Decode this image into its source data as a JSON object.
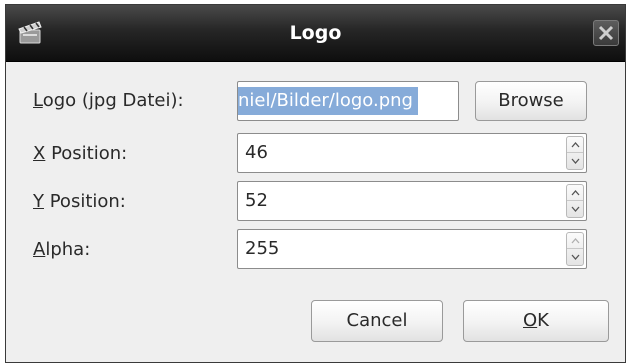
{
  "window": {
    "title": "Logo",
    "app_icon": "clapperboard-icon",
    "close_icon": "close-icon"
  },
  "form": {
    "logo_label_mnemonic": "L",
    "logo_label_rest": "ogo (jpg Datei):",
    "logo_value": "niel/Bilder/logo.png",
    "browse_label": "Browse",
    "x_label_mnemonic": "X",
    "x_label_rest": " Position:",
    "x_value": "46",
    "y_label_mnemonic": "Y",
    "y_label_rest": " Position:",
    "y_value": "52",
    "alpha_label_mnemonic": "A",
    "alpha_label_rest": "lpha:",
    "alpha_value": "255"
  },
  "buttons": {
    "cancel_label": "Cancel",
    "ok_mnemonic": "O",
    "ok_rest": "K"
  },
  "colors": {
    "titlebar": "#1a1a1a",
    "selection": "#86abd9",
    "dialog_bg": "#efefef"
  }
}
